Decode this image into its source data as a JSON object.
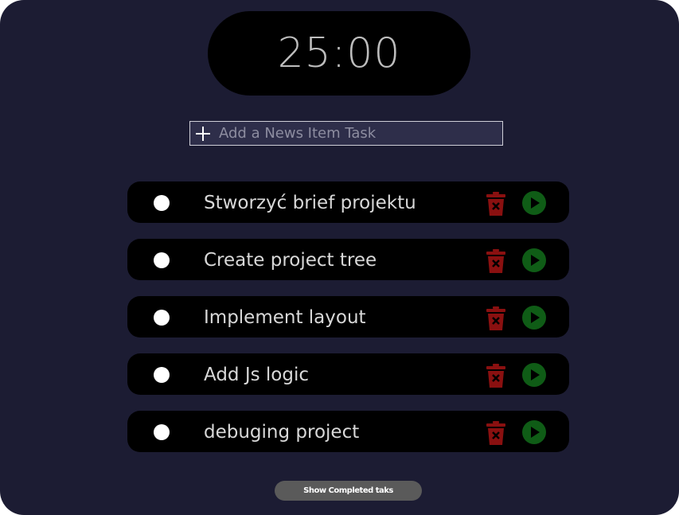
{
  "timer": {
    "display": "25:00"
  },
  "add_task": {
    "placeholder": "Add a News Item Task"
  },
  "tasks": [
    {
      "label": "Stworzyć brief projektu"
    },
    {
      "label": "Create project tree"
    },
    {
      "label": "Implement layout"
    },
    {
      "label": "Add Js logic"
    },
    {
      "label": "debuging project"
    }
  ],
  "show_completed": {
    "label": "Show Completed taks"
  },
  "icons": {
    "add": "plus-icon",
    "delete": "trash-icon",
    "start": "play-icon",
    "complete": "radio-circle"
  },
  "colors": {
    "background": "#1c1c33",
    "card": "#000000",
    "delete": "#8a1010",
    "start": "#0f5c16",
    "button": "#5a5a5a"
  }
}
